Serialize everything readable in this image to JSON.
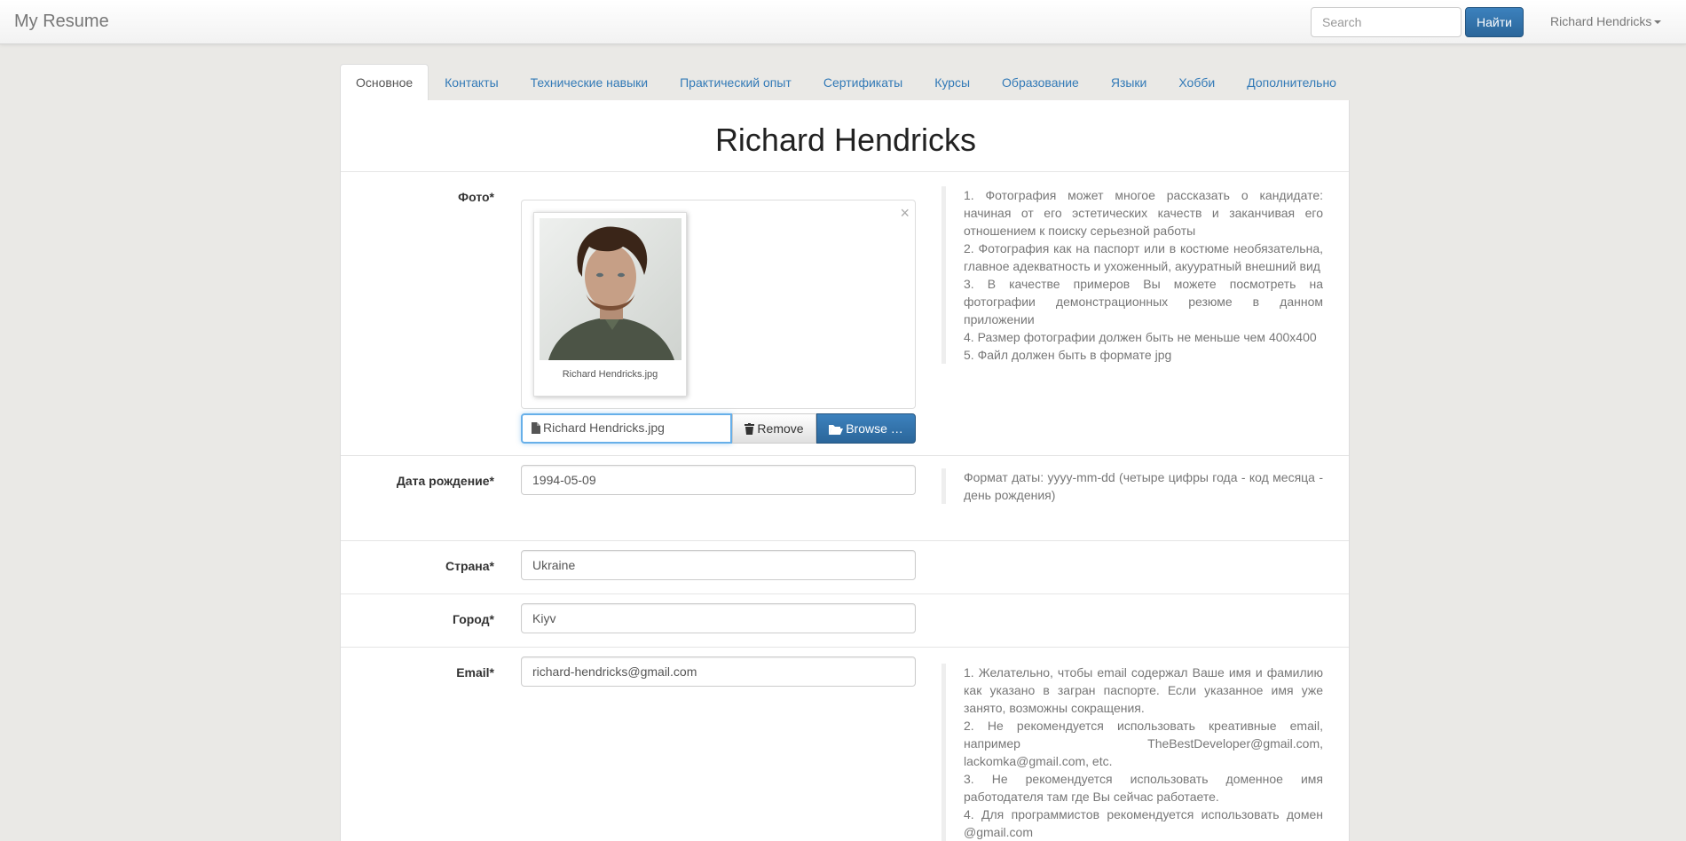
{
  "navbar": {
    "brand": "My Resume",
    "search_placeholder": "Search",
    "search_button": "Найти",
    "user_name": "Richard Hendricks"
  },
  "tabs": [
    {
      "label": "Основное",
      "active": true
    },
    {
      "label": "Контакты"
    },
    {
      "label": "Технические навыки"
    },
    {
      "label": "Практический опыт"
    },
    {
      "label": "Сертификаты"
    },
    {
      "label": "Курсы"
    },
    {
      "label": "Образование"
    },
    {
      "label": "Языки"
    },
    {
      "label": "Хобби"
    },
    {
      "label": "Дополнительно"
    }
  ],
  "profile": {
    "name": "Richard Hendricks",
    "photo": {
      "label": "Фото*",
      "caption": "Richard Hendricks.jpg",
      "file_name": "Richard Hendricks.jpg",
      "remove_label": "Remove",
      "browse_label": "Browse …",
      "help": [
        "1. Фотография может многое рассказать о кандидате: начиная от его эстетических качеств и заканчивая его отношением к поиску серьезной работы",
        "2. Фотография как на паспорт или в костюме необязательна, главное адекватность и ухоженный, акууратный внешний вид",
        "3. В качестве примеров Вы можете посмотреть на фотографии демонстрационных резюме в данном приложении",
        "4. Размер фотографии должен быть не меньше чем 400x400",
        "5. Файл должен быть в формате jpg"
      ]
    },
    "birth_date": {
      "label": "Дата рождение*",
      "value": "1994-05-09",
      "help": "Формат даты: yyyy-mm-dd (четыре цифры года - код месяца - день рождения)"
    },
    "country": {
      "label": "Страна*",
      "value": "Ukraine"
    },
    "city": {
      "label": "Город*",
      "value": "Kiyv"
    },
    "email": {
      "label": "Email*",
      "value": "richard-hendricks@gmail.com",
      "help": [
        "1. Желательно, чтобы email содержал Ваше имя и фамилию как указано в загран паспорте. Если указанное имя уже занято, возможны сокращения.",
        "2. Не рекомендуется использовать креативные email, например TheBestDeveloper@gmail.com, lackomka@gmail.com, etc.",
        "3. Не рекомендуется использовать доменное имя работодателя там где Вы сейчас работаете.",
        "4. Для программистов рекомендуется использовать домен @gmail.com"
      ]
    }
  },
  "colors": {
    "primary": "#337ab7",
    "background": "#eae9e6"
  }
}
